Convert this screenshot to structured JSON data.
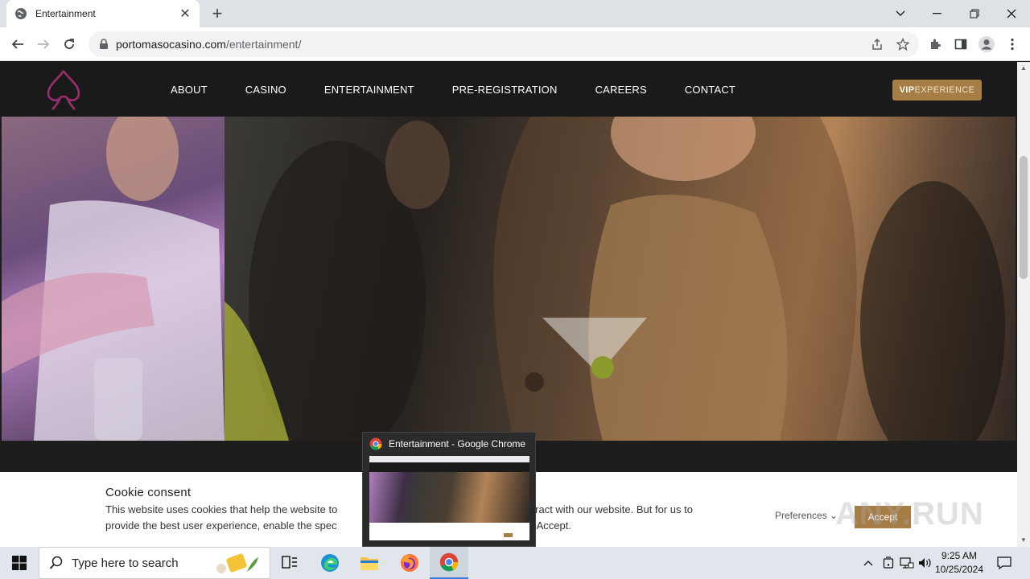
{
  "browser": {
    "tab_title": "Entertainment",
    "url_host": "portomasocasino.com",
    "url_path": "/entertainment/",
    "new_tab_symbol": "+",
    "close_tab_symbol": "✕"
  },
  "site": {
    "nav": [
      "ABOUT",
      "CASINO",
      "ENTERTAINMENT",
      "PRE-REGISTRATION",
      "CAREERS",
      "CONTACT"
    ],
    "vip_bold": "VIP",
    "vip_rest": "EXPERIENCE",
    "brand_color": "#a57d45",
    "logo_color": "#9b2d6e"
  },
  "cookie": {
    "title": "Cookie consent",
    "body_line1": "This website uses cookies that help the website to",
    "body_line1_end": "u interact with our website. But for us to",
    "body_line2": "provide the best user experience, enable the spec",
    "body_line2_end": "ck on Accept.",
    "preferences": "Preferences",
    "accept": "Accept"
  },
  "watermark": "ANY.RUN",
  "preview": {
    "title": "Entertainment - Google Chrome"
  },
  "taskbar": {
    "search_placeholder": "Type here to search",
    "time": "9:25 AM",
    "date": "10/25/2024",
    "icons": [
      "task-view-icon",
      "edge-icon",
      "file-explorer-icon",
      "firefox-icon",
      "chrome-icon"
    ]
  }
}
